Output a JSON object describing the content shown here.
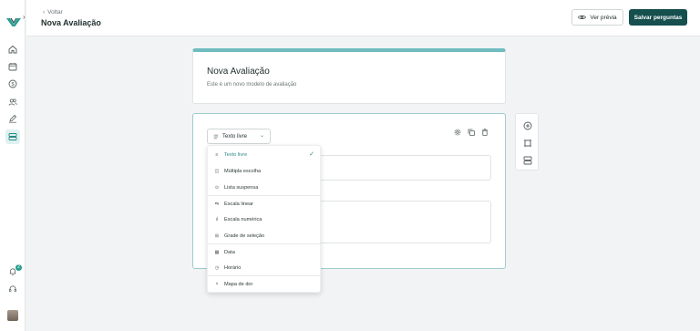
{
  "header": {
    "back_label": "Voltar",
    "title": "Nova Avaliação",
    "preview_label": "Ver prévia",
    "save_label": "Salvar perguntas"
  },
  "sidebar": {
    "items": [
      {
        "icon": "home-icon"
      },
      {
        "icon": "calendar-icon"
      },
      {
        "icon": "dollar-icon"
      },
      {
        "icon": "users-icon"
      },
      {
        "icon": "pen-icon"
      },
      {
        "icon": "forms-icon",
        "active": true
      }
    ],
    "notification_count": "2"
  },
  "form": {
    "title": "Nova Avaliação",
    "description": "Este é um novo modelo de avaliação"
  },
  "question": {
    "type_selected": "Texto livre"
  },
  "type_menu": {
    "items": [
      {
        "label": "Texto livre",
        "icon": "text-lines-icon",
        "selected": true
      },
      {
        "label": "Múltipla escolha",
        "icon": "multiple-choice-icon"
      },
      {
        "label": "Lista suspensa",
        "icon": "dropdown-list-icon"
      },
      {
        "label": "Escala linear",
        "icon": "linear-scale-icon"
      },
      {
        "label": "Escala numérica",
        "icon": "numeric-scale-icon"
      },
      {
        "label": "Grade de seleção",
        "icon": "grid-icon"
      },
      {
        "label": "Data",
        "icon": "calendar-icon"
      },
      {
        "label": "Horário",
        "icon": "clock-icon"
      },
      {
        "label": "Mapa de dor",
        "icon": "body-map-icon"
      }
    ]
  },
  "colors": {
    "accent": "#154f4e",
    "accent_light": "#6fbcc0",
    "selected_text": "#2a8a86"
  }
}
